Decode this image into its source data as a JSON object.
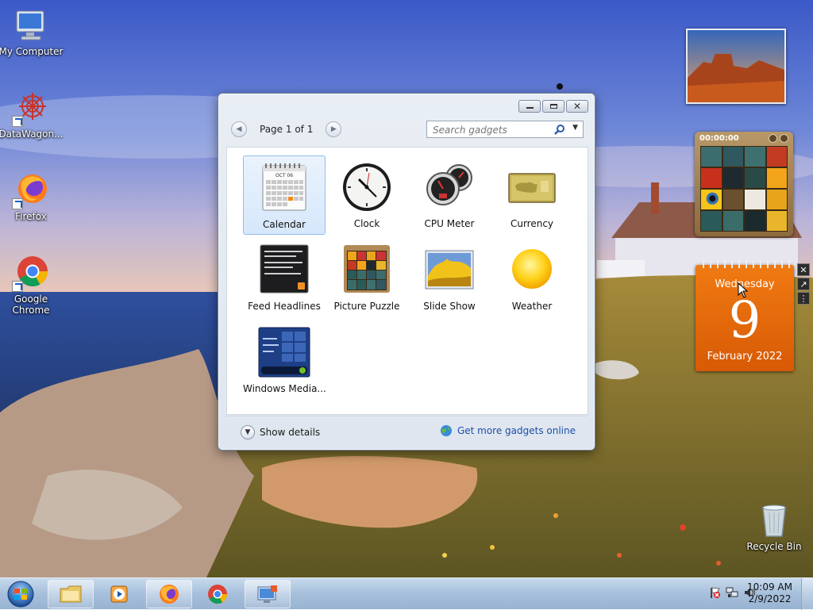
{
  "desktop": {
    "icons": [
      {
        "label": "My Computer",
        "icon": "computer-icon"
      },
      {
        "label": "DataWagon...",
        "icon": "datawagon-icon"
      },
      {
        "label": "Firefox",
        "icon": "firefox-icon"
      },
      {
        "label": "Google Chrome",
        "icon": "chrome-icon"
      },
      {
        "label": "Recycle Bin",
        "icon": "recycle-bin-icon"
      }
    ]
  },
  "gallery": {
    "pager_text": "Page 1 of 1",
    "search_placeholder": "Search gadgets",
    "gadgets": [
      {
        "label": "Calendar",
        "selected": true
      },
      {
        "label": "Clock"
      },
      {
        "label": "CPU Meter"
      },
      {
        "label": "Currency"
      },
      {
        "label": "Feed Headlines"
      },
      {
        "label": "Picture Puzzle"
      },
      {
        "label": "Slide Show"
      },
      {
        "label": "Weather"
      },
      {
        "label": "Windows Media..."
      }
    ],
    "mini_calendar_month": "OCT 06",
    "show_details": "Show details",
    "get_more": "Get more gadgets online"
  },
  "sidebar": {
    "puzzle_timer": "00:00:00",
    "calendar": {
      "weekday": "Wednesday",
      "day": "9",
      "month_year": "February 2022"
    }
  },
  "taskbar": {
    "time": "10:09 AM",
    "date": "2/9/2022"
  },
  "colors": {
    "calendar_orange": "#e8690b",
    "link_blue": "#1a4fa8",
    "selection_blue": "#d6e7fb"
  }
}
